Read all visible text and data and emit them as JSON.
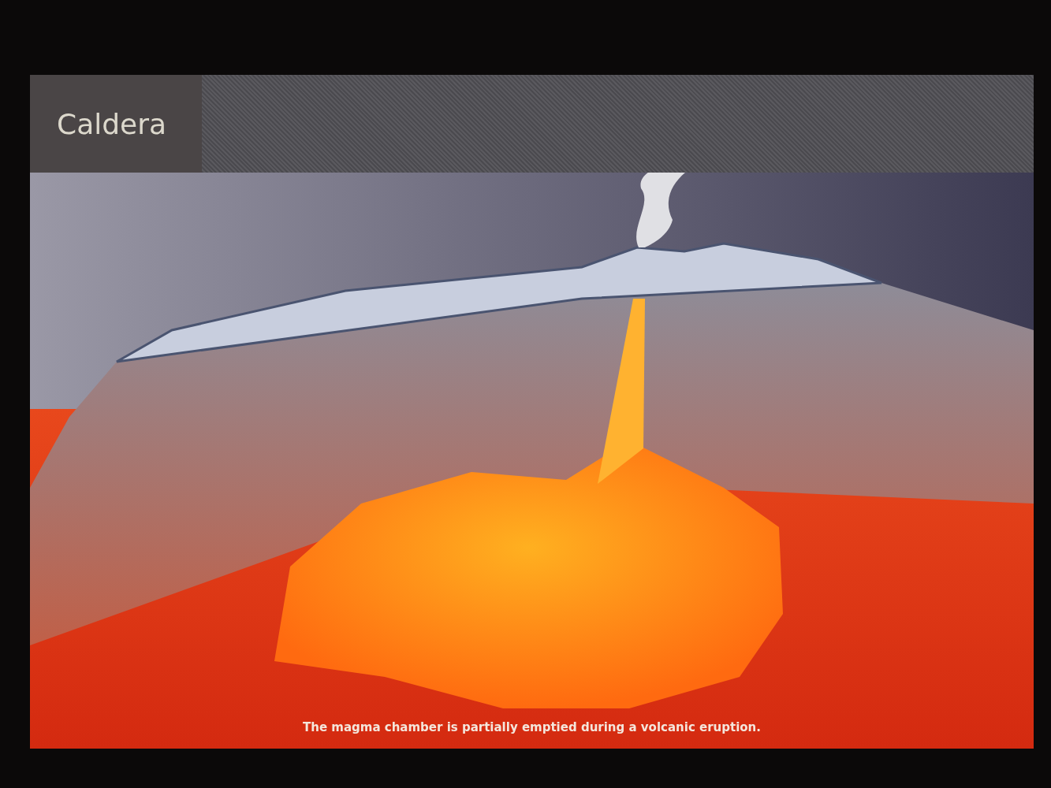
{
  "screen": {
    "title": "Caldera",
    "caption": "The magma chamber is partially emptied during a volcanic eruption."
  }
}
